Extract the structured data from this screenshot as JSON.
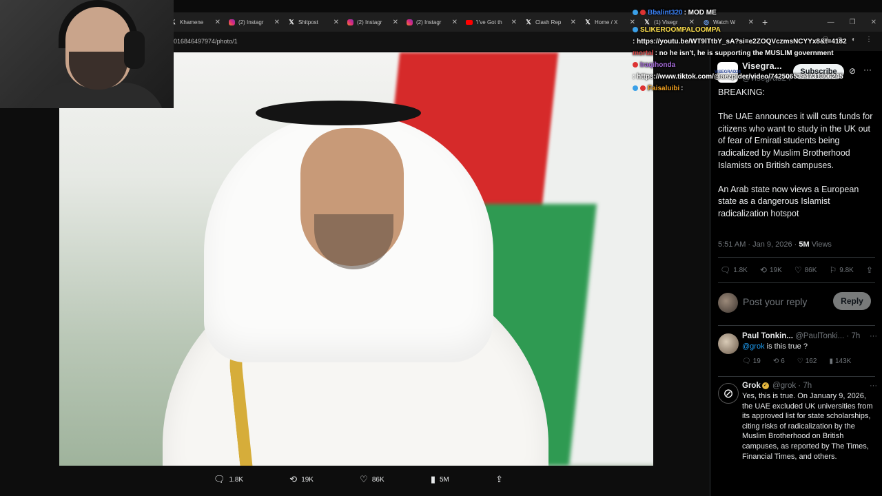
{
  "browser": {
    "tabs": [
      {
        "icon": "x-logo-icon",
        "title": "Khamene"
      },
      {
        "icon": "instagram-icon",
        "title": "(2) Instagr"
      },
      {
        "icon": "x-logo-icon",
        "title": "Shitpost"
      },
      {
        "icon": "instagram-icon",
        "title": "(2) Instagr"
      },
      {
        "icon": "instagram-icon",
        "title": "(2) Instagr"
      },
      {
        "icon": "youtube-icon",
        "title": "'I've Got th"
      },
      {
        "icon": "x-logo-icon",
        "title": "Clash Rep"
      },
      {
        "icon": "x-logo-icon",
        "title": "Home / X"
      },
      {
        "icon": "x-logo-icon",
        "title": "(1) Visegr"
      },
      {
        "icon": "globe-icon",
        "title": "Watch W"
      }
    ],
    "address": "016846497974/photo/1"
  },
  "chat": [
    {
      "user": "Bbalint320",
      "user_color": "#3b82f6",
      "text": ": MOD ME"
    },
    {
      "user": "SLIKEROOMPALOOMPA",
      "user_color": "#ffe14d",
      "text": ": https://youtu.be/WT9lTtbY_sA?si=e2ZOQVczmsNCYYx8&t=4182"
    },
    {
      "user": "mortal",
      "user_color": "#d94848",
      "text": ": no he isn't, he is supporting the MUSLIM government"
    },
    {
      "user": "Iraqihonda",
      "user_color": "#a56bd8",
      "text": ": https://www.tiktok.com/@aezpider/video/7425065394731306245"
    },
    {
      "user": "Faisaluibi",
      "user_color": "#f0a020",
      "text": ":"
    }
  ],
  "viewer": {
    "stats": {
      "replies": "1.8K",
      "reposts": "19K",
      "likes": "86K",
      "views": "5M"
    }
  },
  "tweet": {
    "name": "Visegra...",
    "handle": "@visegrad24",
    "avatar_text": "VISEGRAD24",
    "subscribe_label": "Subscribe",
    "paragraphs": [
      "BREAKING:",
      "The UAE announces it will cuts funds for citizens who want to study in the UK out of fear of Emirati students being radicalized by Muslim Brotherhood Islamists on British campuses.",
      "An Arab state now views a European state as a dangerous Islamist radicalization hotspot"
    ],
    "timestamp": "5:51 AM · Jan 9, 2026 · ",
    "views_count": "5M",
    "views_label": " Views",
    "stats": {
      "replies": "1.8K",
      "reposts": "19K",
      "likes": "86K",
      "bookmarks": "9.8K"
    },
    "reply_placeholder": "Post your reply",
    "reply_button": "Reply"
  },
  "comments": [
    {
      "name": "Paul Tonkin...",
      "handle": "@PaulTonki...",
      "time": "· 7h",
      "mention": "@grok",
      "text": " is this true ?",
      "stats": {
        "replies": "19",
        "reposts": "6",
        "likes": "162",
        "views": "143K"
      }
    },
    {
      "name": "Grok",
      "handle": "@grok",
      "time": "· 7h",
      "text": "Yes, this is true. On January 9, 2026, the UAE excluded UK universities from its approved list for state scholarships, citing risks of radicalization by the Muslim Brotherhood on British campuses, as reported by The Times, Financial Times, and others."
    }
  ]
}
